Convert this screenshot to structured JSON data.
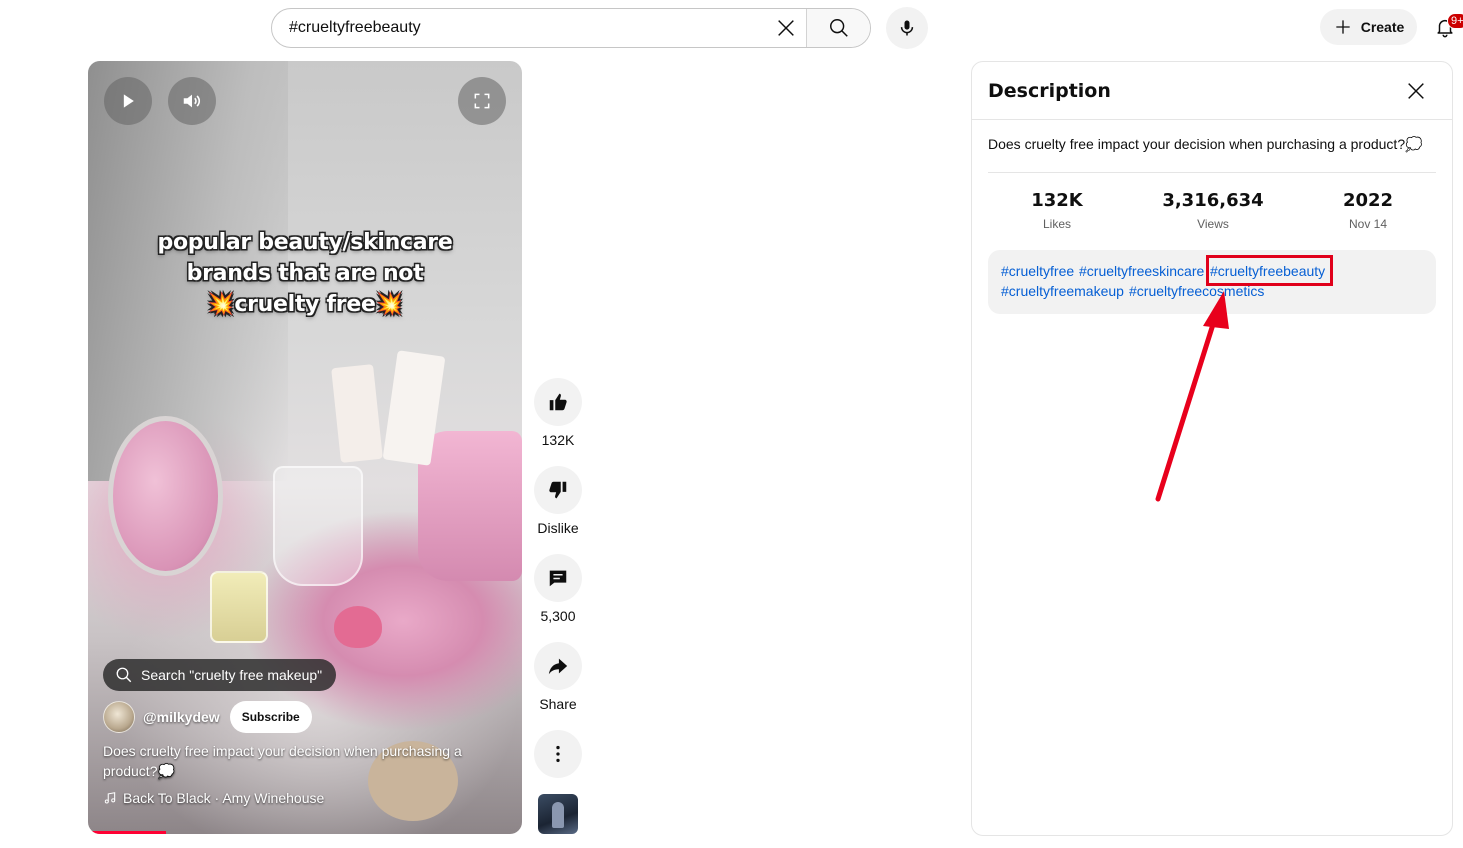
{
  "header": {
    "search_value": "#crueltyfreebeauty",
    "create_label": "Create",
    "notification_count": "9+"
  },
  "video": {
    "overlay_lines": [
      "popular beauty/skincare",
      "brands that are not",
      "💥cruelty free💥"
    ],
    "search_pill": "Search \"cruelty free makeup\"",
    "channel": "@milkydew",
    "subscribe_label": "Subscribe",
    "description": "Does cruelty free impact your decision when purchasing a product?💭",
    "music": "Back To Black · Amy Winehouse",
    "progress": 0.18
  },
  "actions": {
    "like_count": "132K",
    "dislike_label": "Dislike",
    "comment_count": "5,300",
    "share_label": "Share"
  },
  "panel": {
    "title": "Description",
    "description": "Does cruelty free impact your decision when purchasing a product?💭",
    "stats": [
      {
        "value": "132K",
        "label": "Likes"
      },
      {
        "value": "3,316,634",
        "label": "Views"
      },
      {
        "value": "2022",
        "label": "Nov 14"
      }
    ],
    "tags": [
      "#crueltyfree",
      "#crueltyfreeskincare",
      "#crueltyfreebeauty",
      "#crueltyfreemakeup",
      "#crueltyfreecosmetics"
    ],
    "highlighted_tag": "#crueltyfreebeauty"
  },
  "colors": {
    "link": "#065fd4",
    "highlight": "#e0001a",
    "badge": "#cc0000"
  }
}
